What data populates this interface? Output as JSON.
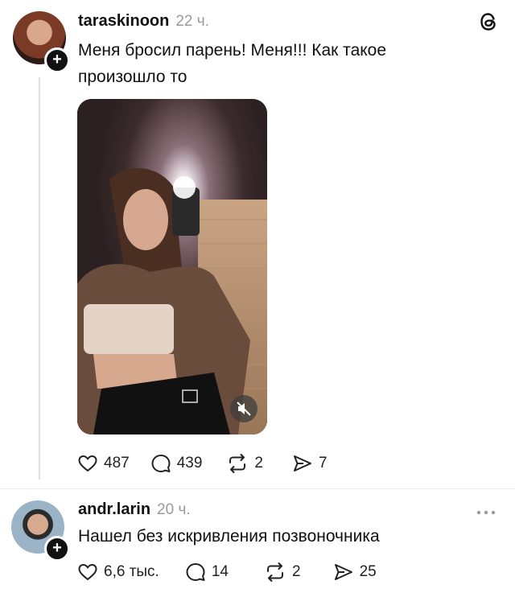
{
  "post": {
    "username": "taraskinoon",
    "time": "22 ч.",
    "text_line1": "Меня бросил парень! Меня!!! Как такое",
    "text_line2": "произошло то",
    "likes": "487",
    "comments": "439",
    "reposts": "2",
    "shares": "7"
  },
  "reply": {
    "username": "andr.larin",
    "time": "20 ч.",
    "text": "Нашел без искривления позвоночника",
    "likes": "6,6 тыс.",
    "comments": "14",
    "reposts": "2",
    "shares": "25"
  },
  "icons": {
    "app_logo": "threads-logo-icon",
    "like": "heart-icon",
    "comment": "comment-bubble-icon",
    "repost": "repost-icon",
    "share": "send-icon",
    "mute": "muted-speaker-icon",
    "more": "more-icon"
  },
  "colors": {
    "text": "#111111",
    "muted": "#9a9a9a",
    "thread_line": "#dedede"
  }
}
